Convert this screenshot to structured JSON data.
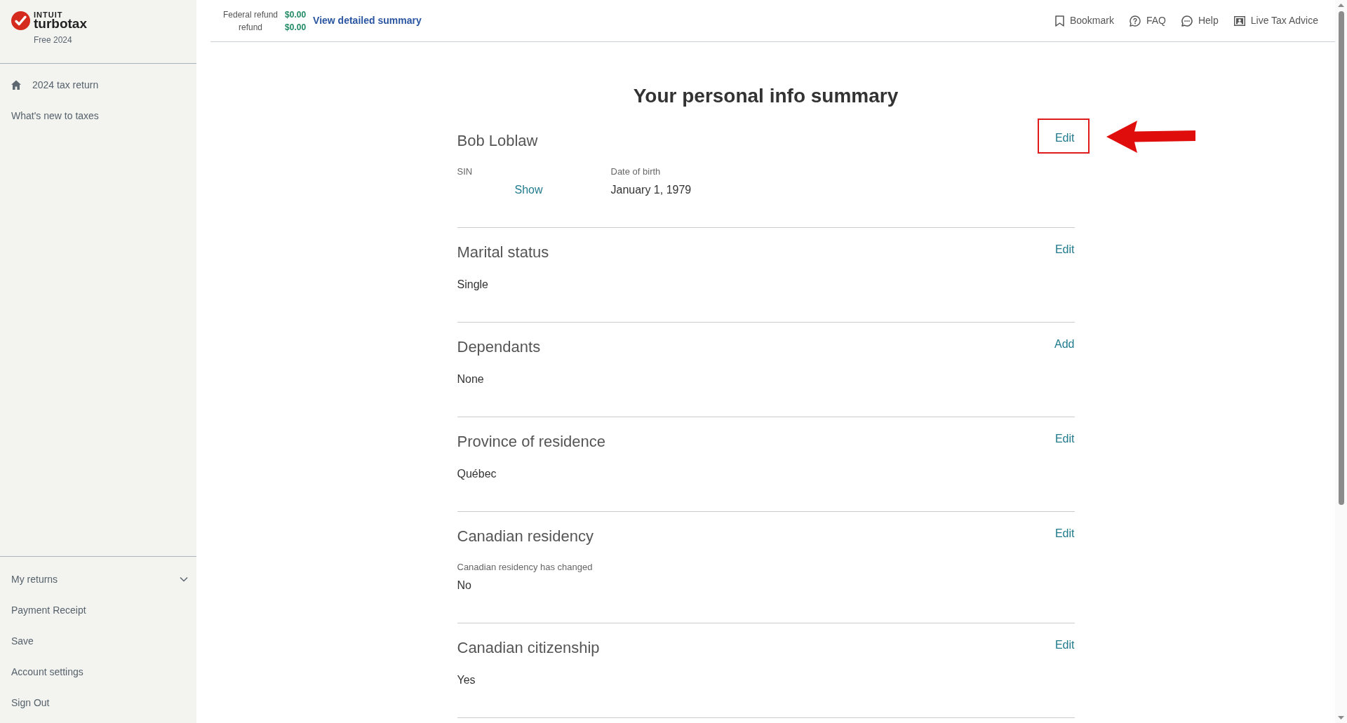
{
  "sidebar": {
    "logo": {
      "company": "INTUIT",
      "product": "turbotax",
      "edition": "Free 2024"
    },
    "top_items": [
      {
        "label": "2024 tax return",
        "kind": "home"
      },
      {
        "label": "What's new to taxes",
        "kind": "link"
      }
    ],
    "bottom_items": [
      {
        "label": "My returns",
        "kind": "dropdown",
        "expanded": false
      },
      {
        "label": "Payment Receipt",
        "kind": "link"
      },
      {
        "label": "Save",
        "kind": "link"
      },
      {
        "label": "Account settings",
        "kind": "link"
      },
      {
        "label": "Sign Out",
        "kind": "link"
      }
    ]
  },
  "header": {
    "refunds": [
      {
        "label": "Federal refund",
        "amount": "$0.00"
      },
      {
        "label": "refund",
        "amount": "$0.00"
      }
    ],
    "summary_link": "View detailed summary",
    "actions": [
      {
        "label": "Bookmark",
        "kind": "bookmark"
      },
      {
        "label": "FAQ",
        "kind": "faq"
      },
      {
        "label": "Help",
        "kind": "help"
      },
      {
        "label": "Live Tax Advice",
        "kind": "live_advice"
      }
    ]
  },
  "main": {
    "title": "Your personal info summary",
    "sections": [
      {
        "heading": "Bob Loblaw",
        "action": "Edit",
        "highlighted": true,
        "fields": [
          {
            "label": "SIN",
            "value": "Show",
            "kind": "reveal"
          },
          {
            "label": "Date of birth",
            "value": "January 1, 1979",
            "kind": "text"
          }
        ]
      },
      {
        "heading": "Marital status",
        "action": "Edit",
        "highlighted": false,
        "fields": [
          {
            "value": "Single",
            "kind": "text"
          }
        ]
      },
      {
        "heading": "Dependants",
        "action": "Add",
        "highlighted": false,
        "fields": [
          {
            "value": "None",
            "kind": "text"
          }
        ]
      },
      {
        "heading": "Province of residence",
        "action": "Edit",
        "highlighted": false,
        "fields": [
          {
            "value": "Québec",
            "kind": "text"
          }
        ]
      },
      {
        "heading": "Canadian residency",
        "action": "Edit",
        "highlighted": false,
        "fields": [
          {
            "label": "Canadian residency has changed",
            "value": "No",
            "kind": "text"
          }
        ]
      },
      {
        "heading": "Canadian citizenship",
        "action": "Edit",
        "highlighted": false,
        "fields": [
          {
            "value": "Yes",
            "kind": "text"
          }
        ]
      }
    ]
  }
}
